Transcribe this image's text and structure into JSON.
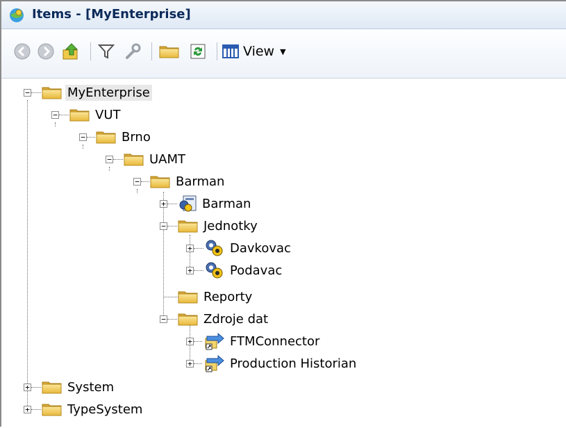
{
  "window": {
    "title": "Items - [MyEnterprise]"
  },
  "toolbar": {
    "view_label": "View",
    "buttons": [
      "back-icon",
      "forward-icon",
      "up-folder-icon",
      "filter-icon",
      "wrench-icon",
      "folder-icon",
      "refresh-icon",
      "columns-view-icon"
    ]
  },
  "tree": {
    "root": "MyEnterprise",
    "vut": "VUT",
    "brno": "Brno",
    "uamt": "UAMT",
    "barman_folder": "Barman",
    "barman_item": "Barman",
    "jednotky": "Jednotky",
    "davkovac": "Davkovac",
    "podavac": "Podavac",
    "reporty": "Reporty",
    "zdroje_dat": "Zdroje dat",
    "ftm": "FTMConnector",
    "historian": "Production Historian",
    "system": "System",
    "typesystem": "TypeSystem"
  },
  "colors": {
    "folder": "#f2cc52",
    "folder_dark": "#c99a1e",
    "title_text": "#0b2a5a"
  }
}
